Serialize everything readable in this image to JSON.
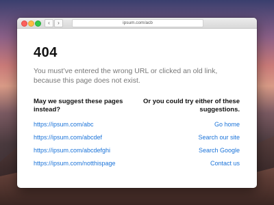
{
  "browser": {
    "url": "ipsum.com/acb",
    "back_glyph": "‹",
    "forward_glyph": "›"
  },
  "error": {
    "code": "404",
    "message": "You must’ve entered the wrong URL or clicked an old link, because this page does not exist."
  },
  "suggestions": {
    "left_heading": "May we suggest these pages instead?",
    "links": [
      "https://ipsum.com/abc",
      "https://ipsum.com/abcdef",
      "https://ipsum.com/abcdefghi",
      "https://ipsum.com/notthispage"
    ]
  },
  "alternatives": {
    "right_heading": "Or you could try either of these suggestions.",
    "links": [
      "Go home",
      "Search our site",
      "Search Google",
      "Contact us"
    ]
  },
  "colors": {
    "link": "#1a73d9",
    "close": "#fc605c",
    "minimize": "#fdbc40",
    "zoom": "#34c84a"
  }
}
